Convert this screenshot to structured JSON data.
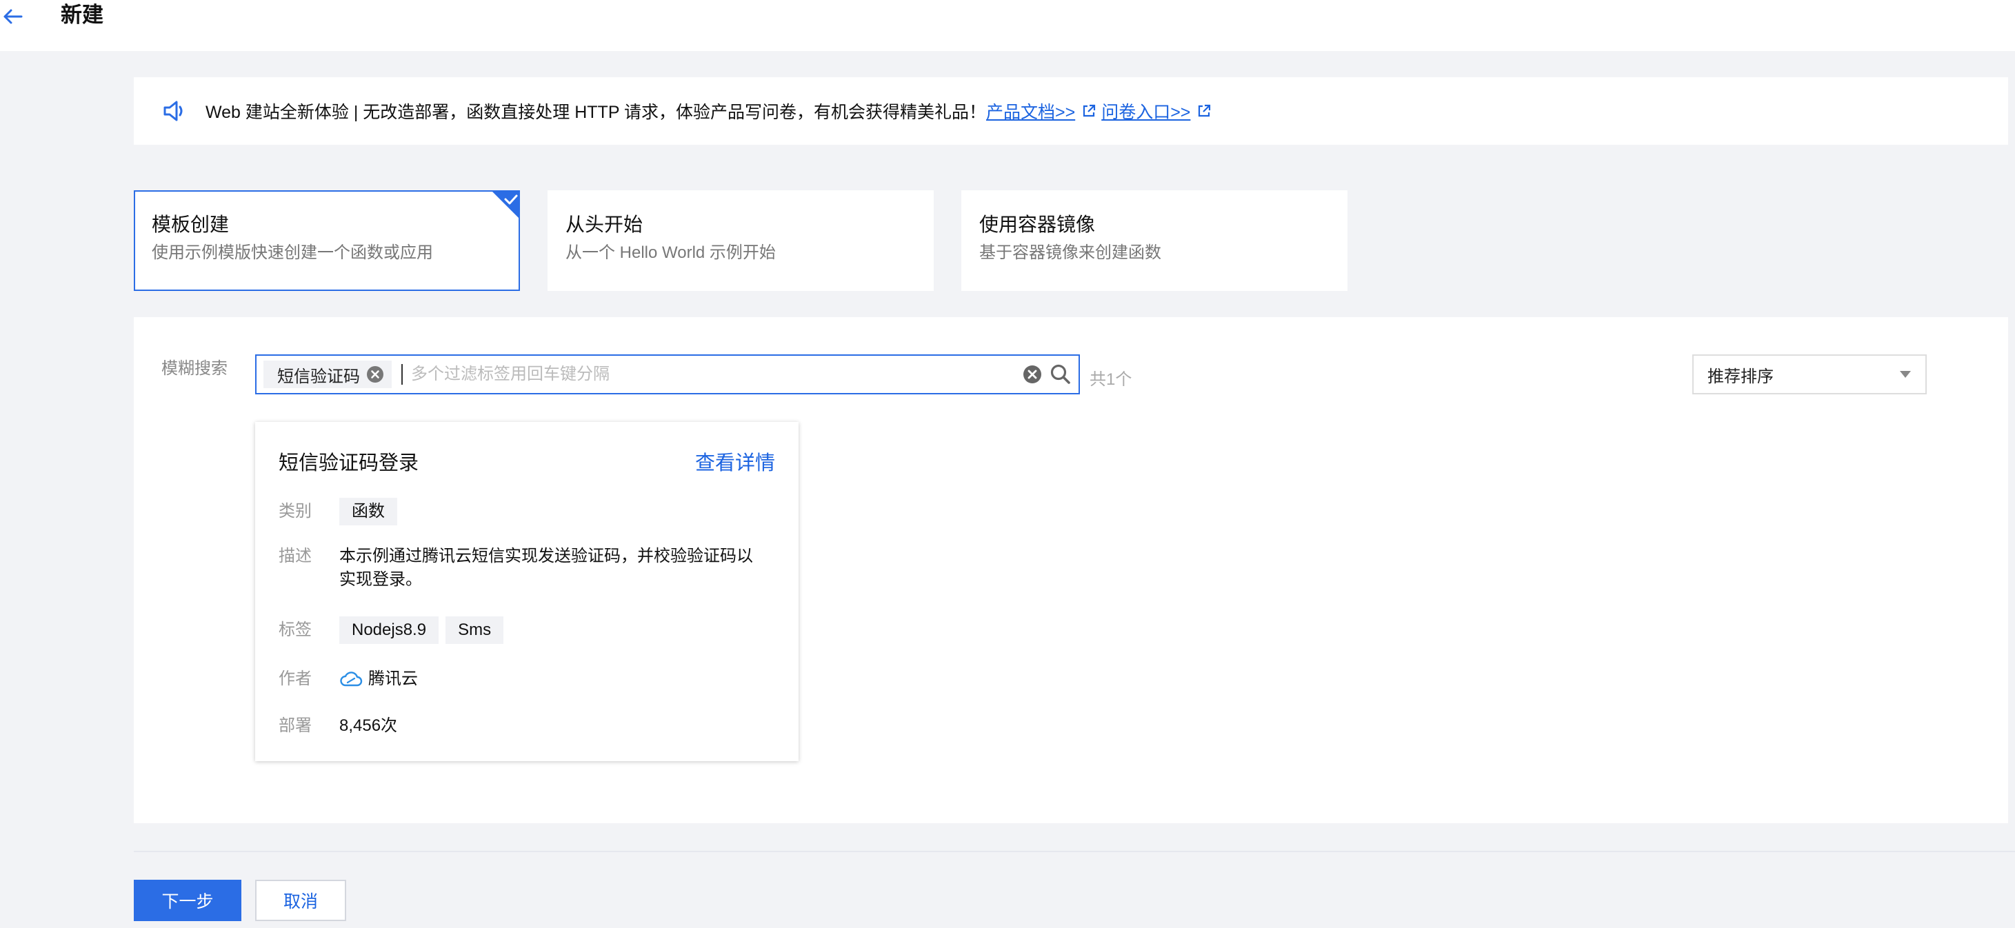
{
  "header": {
    "title": "新建",
    "back_icon": "arrow-left-icon"
  },
  "notice": {
    "text": "Web 建站全新体验 | 无改造部署，函数直接处理 HTTP 请求，体验产品写问卷，有机会获得精美礼品！",
    "link_docs": "产品文档>>",
    "link_survey": "问卷入口>>"
  },
  "create_types": [
    {
      "title": "模板创建",
      "desc": "使用示例模版快速创建一个函数或应用",
      "selected": true
    },
    {
      "title": "从头开始",
      "desc": "从一个 Hello World 示例开始",
      "selected": false
    },
    {
      "title": "使用容器镜像",
      "desc": "基于容器镜像来创建函数",
      "selected": false
    }
  ],
  "search": {
    "label": "模糊搜索",
    "tag": "短信验证码",
    "placeholder": "多个过滤标签用回车键分隔",
    "count": "共1个"
  },
  "sort": {
    "selected": "推荐排序"
  },
  "template": {
    "title": "短信验证码登录",
    "detail_link": "查看详情",
    "category_label": "类别",
    "category": "函数",
    "desc_label": "描述",
    "desc": "本示例通过腾讯云短信实现发送验证码，并校验验证码以实现登录。",
    "tags_label": "标签",
    "tags": [
      "Nodejs8.9",
      "Sms"
    ],
    "author_label": "作者",
    "author": "腾讯云",
    "deploy_label": "部署",
    "deploys": "8,456次"
  },
  "footer": {
    "next": "下一步",
    "cancel": "取消"
  },
  "colors": {
    "accent": "#2b6de5",
    "link": "#1b63e0",
    "background": "#f2f3f6"
  }
}
